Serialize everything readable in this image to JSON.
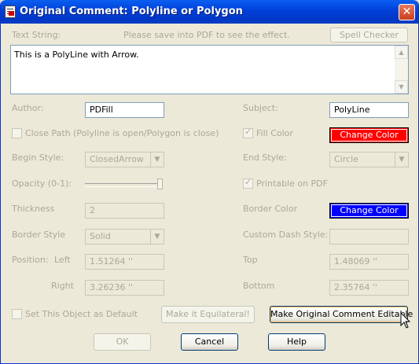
{
  "window": {
    "title": "Original Comment: Polyline or Polygon"
  },
  "text_string": {
    "label": "Text String:",
    "hint": "Please save into PDF to see the effect.",
    "spell_checker_label": "Spell Checker",
    "value": "This is a PolyLine with Arrow."
  },
  "author": {
    "label": "Author:",
    "value": "PDFill"
  },
  "subject": {
    "label": "Subject:",
    "value": "PolyLine"
  },
  "close_path": {
    "label": "Close Path (Polyline is open/Polygon is close)"
  },
  "fill_color": {
    "label": "Fill Color",
    "button": "Change Color",
    "color": "#ff0000"
  },
  "begin_style": {
    "label": "Begin Style:",
    "value": "ClosedArrow"
  },
  "end_style": {
    "label": "End Style:",
    "value": "Circle"
  },
  "opacity": {
    "label": "Opacity (0-1):",
    "value": 1
  },
  "printable": {
    "label": "Printable on PDF"
  },
  "thickness": {
    "label": "Thickness",
    "value": "2"
  },
  "border_color": {
    "label": "Border Color",
    "button": "Change Color",
    "color": "#0000ff"
  },
  "border_style": {
    "label": "Border Style",
    "value": "Solid"
  },
  "custom_dash": {
    "label": "Custom Dash Style:",
    "value": ""
  },
  "position": {
    "label": "Position:",
    "left_label": "Left",
    "left": "1.51264 ''",
    "right_label": "Right",
    "right": "3.26236 ''",
    "top_label": "Top",
    "top": "1.48069 ''",
    "bottom_label": "Bottom",
    "bottom": "2.35764 ''"
  },
  "default": {
    "label": "Set This Object as Default"
  },
  "buttons": {
    "equilateral": "Make it Equilateral!",
    "editable": "Make Original Comment Editable",
    "ok": "OK",
    "cancel": "Cancel",
    "help": "Help"
  }
}
